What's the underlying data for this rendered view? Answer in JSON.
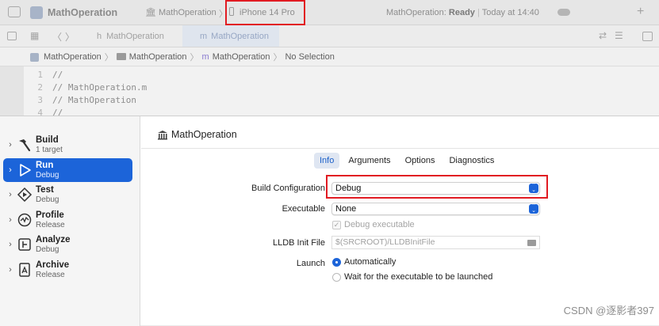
{
  "titlebar": {
    "app_name": "MathOperation",
    "scheme_name": "MathOperation",
    "device": "iPhone 14 Pro",
    "status_target": "MathOperation:",
    "status_state": "Ready",
    "status_time": "Today at 14:40"
  },
  "editor_tabs": [
    {
      "icon": "h",
      "label": "MathOperation"
    },
    {
      "icon": "m",
      "label": "MathOperation"
    }
  ],
  "jumpbar": [
    "MathOperation",
    "MathOperation",
    "MathOperation",
    "No Selection"
  ],
  "code": [
    {
      "ln": "1",
      "text": "//"
    },
    {
      "ln": "2",
      "text": "//  MathOperation.m"
    },
    {
      "ln": "3",
      "text": "//  MathOperation"
    },
    {
      "ln": "4",
      "text": "//"
    }
  ],
  "actions": [
    {
      "name": "Build",
      "sub": "1 target"
    },
    {
      "name": "Run",
      "sub": "Debug"
    },
    {
      "name": "Test",
      "sub": "Debug"
    },
    {
      "name": "Profile",
      "sub": "Release"
    },
    {
      "name": "Analyze",
      "sub": "Debug"
    },
    {
      "name": "Archive",
      "sub": "Release"
    }
  ],
  "selected_action": "Run",
  "target_title": "MathOperation",
  "tabs": [
    "Info",
    "Arguments",
    "Options",
    "Diagnostics"
  ],
  "active_tab": "Info",
  "form": {
    "build_config_label": "Build Configuration",
    "build_config_value": "Debug",
    "executable_label": "Executable",
    "executable_value": "None",
    "debug_executable_label": "Debug executable",
    "debug_executable_checked": true,
    "lldb_label": "LLDB Init File",
    "lldb_placeholder": "$(SRCROOT)/LLDBInitFile",
    "launch_label": "Launch",
    "launch_auto": "Automatically",
    "launch_wait": "Wait for the executable to be launched",
    "launch_selected": "Automatically"
  },
  "watermark": "CSDN @逐影者397",
  "colors": {
    "accent": "#1c64d9",
    "highlight_box": "#e11b22"
  }
}
